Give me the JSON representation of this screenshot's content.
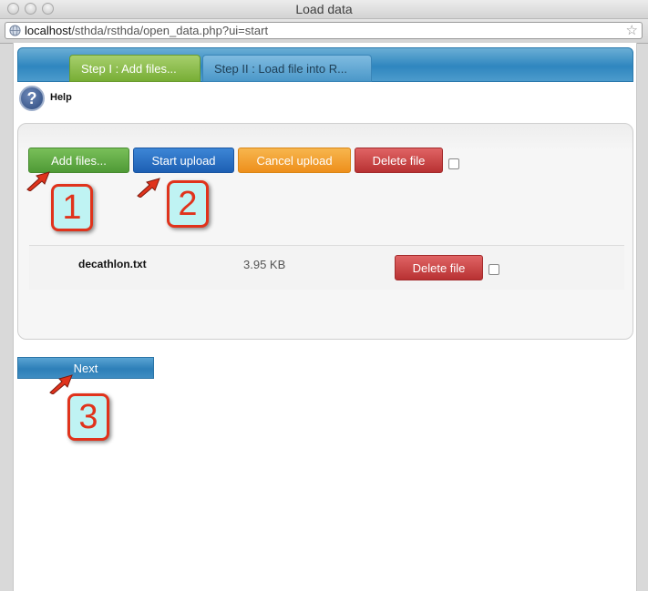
{
  "window": {
    "title": "Load data"
  },
  "address_bar": {
    "host": "localhost",
    "path": "/sthda/rsthda/open_data.php?ui=start"
  },
  "tabs": [
    {
      "label": "Step I : Add files..."
    },
    {
      "label": "Step II : Load file into R..."
    }
  ],
  "help": {
    "label": "Help"
  },
  "toolbar": {
    "add_label": "Add files...",
    "start_label": "Start upload",
    "cancel_label": "Cancel upload",
    "delete_label": "Delete file"
  },
  "files": [
    {
      "name": "decathlon.txt",
      "size": "3.95 KB",
      "delete_label": "Delete file"
    }
  ],
  "next_label": "Next",
  "annotations": [
    "1",
    "2",
    "3"
  ],
  "colors": {
    "green": "#4f9a36",
    "blue": "#1d5fb3",
    "orange": "#ee8f1b",
    "red": "#b83132",
    "annotation_red": "#e0331c",
    "annotation_fill": "#bff3f3"
  }
}
